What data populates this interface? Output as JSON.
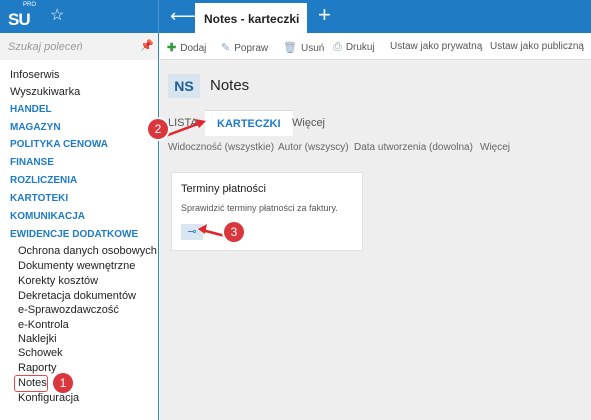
{
  "topbar": {
    "logo_text": "SU",
    "logo_sup": "PRO",
    "tab_title": "Notes - karteczki"
  },
  "sidebar": {
    "search_placeholder": "Szukaj poleceń",
    "items": [
      {
        "label": "Infoserwis"
      },
      {
        "label": "Wyszukiwarka"
      },
      {
        "label": "HANDEL"
      },
      {
        "label": "MAGAZYN"
      },
      {
        "label": "POLITYKA CENOWA"
      },
      {
        "label": "FINANSE"
      },
      {
        "label": "ROZLICZENIA"
      },
      {
        "label": "KARTOTEKI"
      },
      {
        "label": "KOMUNIKACJA"
      },
      {
        "label": "EWIDENCJE DODATKOWE"
      },
      {
        "label": "Ochrona danych osobowych"
      },
      {
        "label": "Dokumenty wewnętrzne"
      },
      {
        "label": "Korekty kosztów"
      },
      {
        "label": "Dekretacja dokumentów"
      },
      {
        "label": "e-Sprawozdawczość"
      },
      {
        "label": "e-Kontrola"
      },
      {
        "label": "Naklejki"
      },
      {
        "label": "Schowek"
      },
      {
        "label": "Raporty"
      },
      {
        "label": "Notes"
      },
      {
        "label": "Konfiguracja"
      }
    ]
  },
  "toolbar": {
    "add": "Dodaj",
    "edit": "Popraw",
    "delete": "Usuń",
    "print": "Drukuj",
    "private": "Ustaw jako prywatną",
    "public": "Ustaw jako publiczną"
  },
  "page": {
    "badge": "NS",
    "title": "Notes"
  },
  "view_tabs": {
    "list": "LISTA",
    "cards": "KARTECZKI",
    "more": "Więcej"
  },
  "filters": {
    "visibility": "Widoczność (wszystkie)",
    "author": "Autor (wszyscy)",
    "created": "Data utworzenia (dowolna)",
    "more": "Więcej"
  },
  "card": {
    "title": "Terminy płatności",
    "text": "Sprawidzić terminy płatności za faktury."
  },
  "annotations": {
    "one": "1",
    "two": "2",
    "three": "3"
  },
  "colors": {
    "accent": "#1e7bc4",
    "annotation": "#d9363e"
  }
}
